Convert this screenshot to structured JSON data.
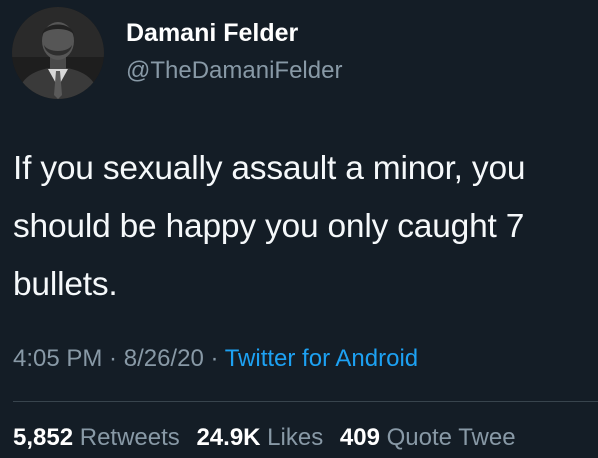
{
  "author": {
    "display_name": "Damani Felder",
    "handle": "@TheDamaniFelder",
    "avatar_icon": "profile-photo"
  },
  "tweet": {
    "lines": [
      "If you sexually assault a minor, you",
      "should be happy you only caught 7",
      "bullets."
    ]
  },
  "meta": {
    "time": "4:05 PM",
    "separator1": " · ",
    "date": "8/26/20",
    "separator2": " · ",
    "source": "Twitter for Android"
  },
  "stats": {
    "retweets_count": "5,852",
    "retweets_label": "Retweets",
    "likes_count": "24.9K",
    "likes_label": "Likes",
    "quotes_count": "409",
    "quotes_label": "Quote Twee"
  },
  "colors": {
    "background": "#141d26",
    "secondary_text": "#8899a6",
    "link": "#1da1f2",
    "divider": "#38444d"
  }
}
